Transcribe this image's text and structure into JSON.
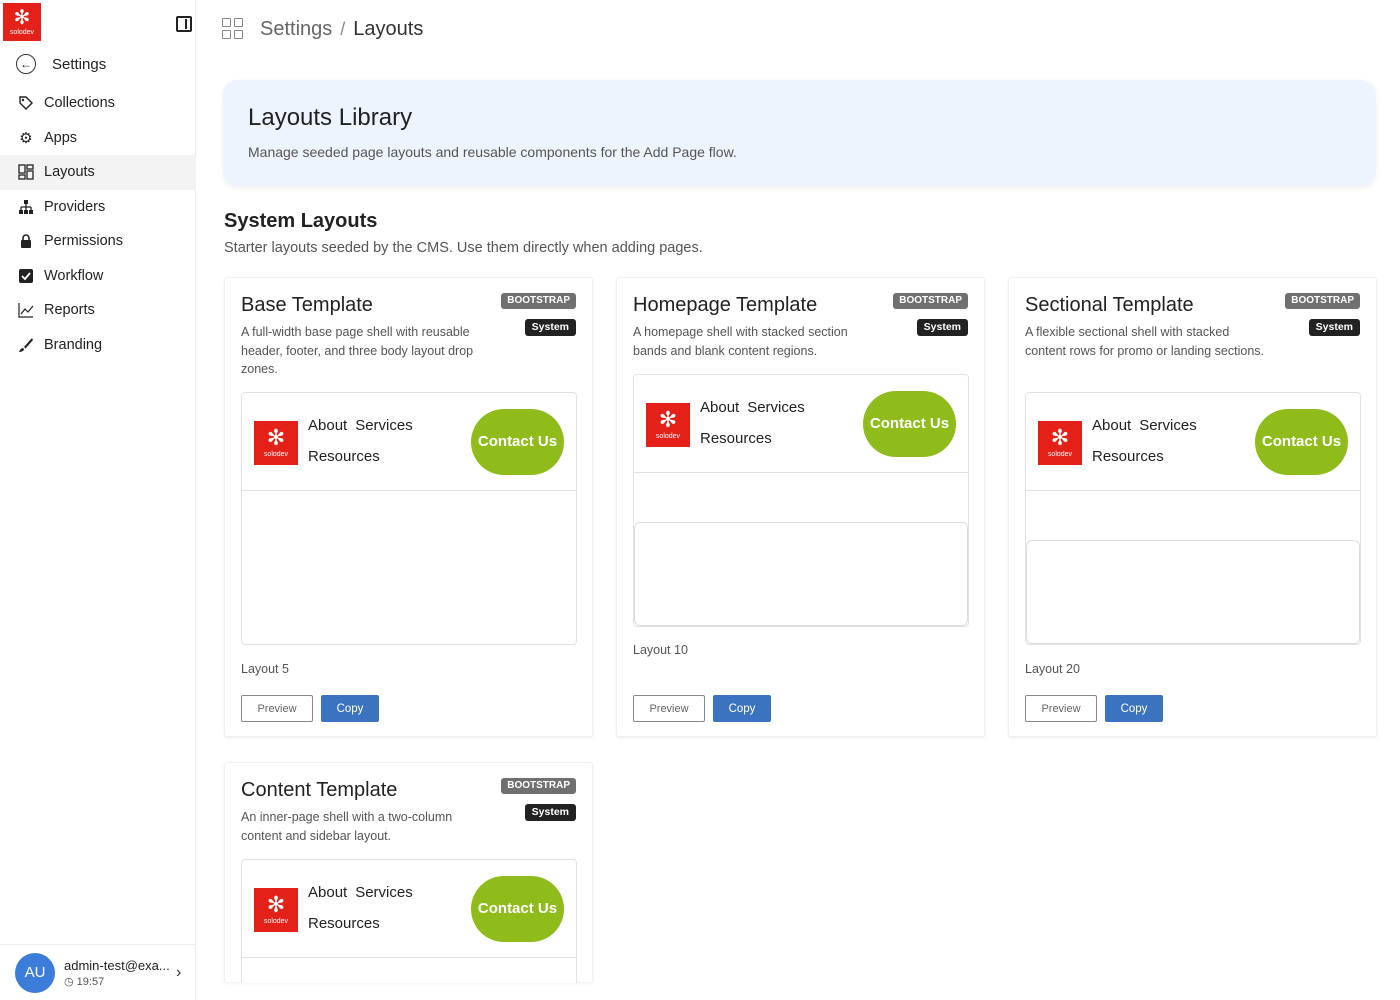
{
  "brand": {
    "logo_text": "solodev",
    "accent": "#e32119",
    "contact_color": "#8fbc1b",
    "button_color": "#3b73c0"
  },
  "sidebar": {
    "back_label": "Settings",
    "items": [
      {
        "label": "Collections",
        "icon": "tag-icon"
      },
      {
        "label": "Apps",
        "icon": "gear-icon"
      },
      {
        "label": "Layouts",
        "icon": "layout-grid-icon",
        "active": true
      },
      {
        "label": "Providers",
        "icon": "hierarchy-icon"
      },
      {
        "label": "Permissions",
        "icon": "lock-icon"
      },
      {
        "label": "Workflow",
        "icon": "checkbox-icon"
      },
      {
        "label": "Reports",
        "icon": "line-chart-icon"
      },
      {
        "label": "Branding",
        "icon": "brush-icon"
      }
    ],
    "user": {
      "initials": "AU",
      "email": "admin-test@exa...",
      "time": "19:57"
    }
  },
  "header": {
    "crumb_parent": "Settings",
    "crumb_sep": "/",
    "crumb_current": "Layouts"
  },
  "hero": {
    "title": "Layouts Library",
    "subtitle": "Manage seeded page layouts and reusable components for the Add Page flow."
  },
  "section": {
    "title": "System Layouts",
    "subtitle": "Starter layouts seeded by the CMS. Use them directly when adding pages."
  },
  "preview_nav": {
    "about": "About",
    "services": "Services",
    "resources": "Resources",
    "contact": "Contact Us"
  },
  "cards": [
    {
      "title": "Base Template",
      "desc": "A full-width base page shell with reusable header, footer, and three body layout drop zones.",
      "badge": "BOOTSTRAP",
      "tag": "System",
      "layout": "Layout 5",
      "preview_btn": "Preview",
      "copy_btn": "Copy"
    },
    {
      "title": "Homepage Template",
      "desc": "A homepage shell with stacked section bands and blank content regions.",
      "badge": "BOOTSTRAP",
      "tag": "System",
      "layout": "Layout 10",
      "preview_btn": "Preview",
      "copy_btn": "Copy"
    },
    {
      "title": "Sectional Template",
      "desc": "A flexible sectional shell with stacked content rows for promo or landing sections.",
      "badge": "BOOTSTRAP",
      "tag": "System",
      "layout": "Layout 20",
      "preview_btn": "Preview",
      "copy_btn": "Copy"
    },
    {
      "title": "Content Template",
      "desc": "An inner-page shell with a two-column content and sidebar layout.",
      "badge": "BOOTSTRAP",
      "tag": "System"
    }
  ]
}
